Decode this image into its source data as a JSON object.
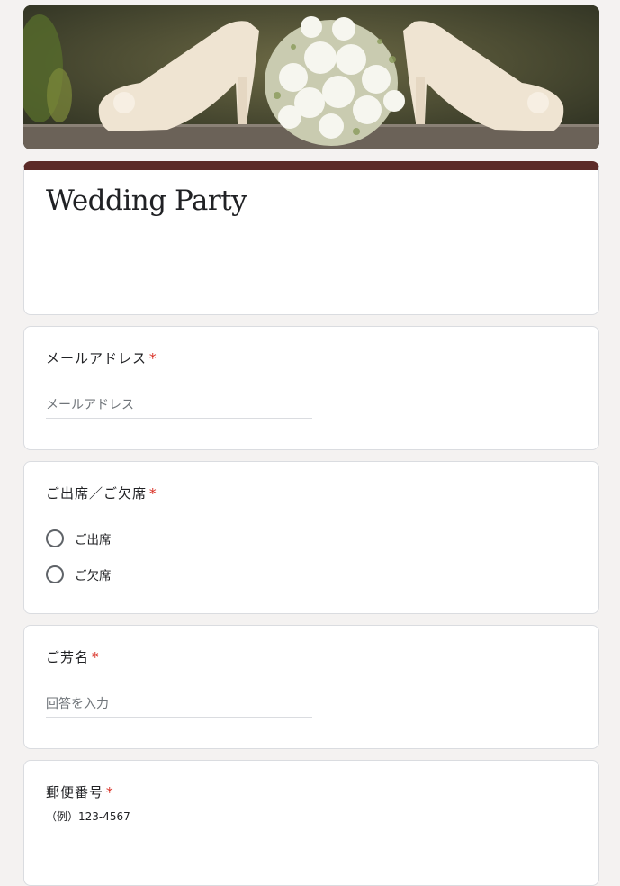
{
  "form": {
    "title": "Wedding Party"
  },
  "questions": {
    "email": {
      "label": "メールアドレス",
      "required_mark": "*",
      "placeholder": "メールアドレス"
    },
    "attendance": {
      "label": "ご出席／ご欠席",
      "required_mark": "*",
      "options": [
        "ご出席",
        "ご欠席"
      ]
    },
    "name": {
      "label": "ご芳名",
      "required_mark": "*",
      "placeholder": "回答を入力"
    },
    "postal": {
      "label": "郵便番号",
      "required_mark": "*",
      "helper": "（例）123-4567"
    }
  },
  "colors": {
    "accent": "#5b2a27",
    "required": "#d93025",
    "background": "#f4f2f1"
  }
}
